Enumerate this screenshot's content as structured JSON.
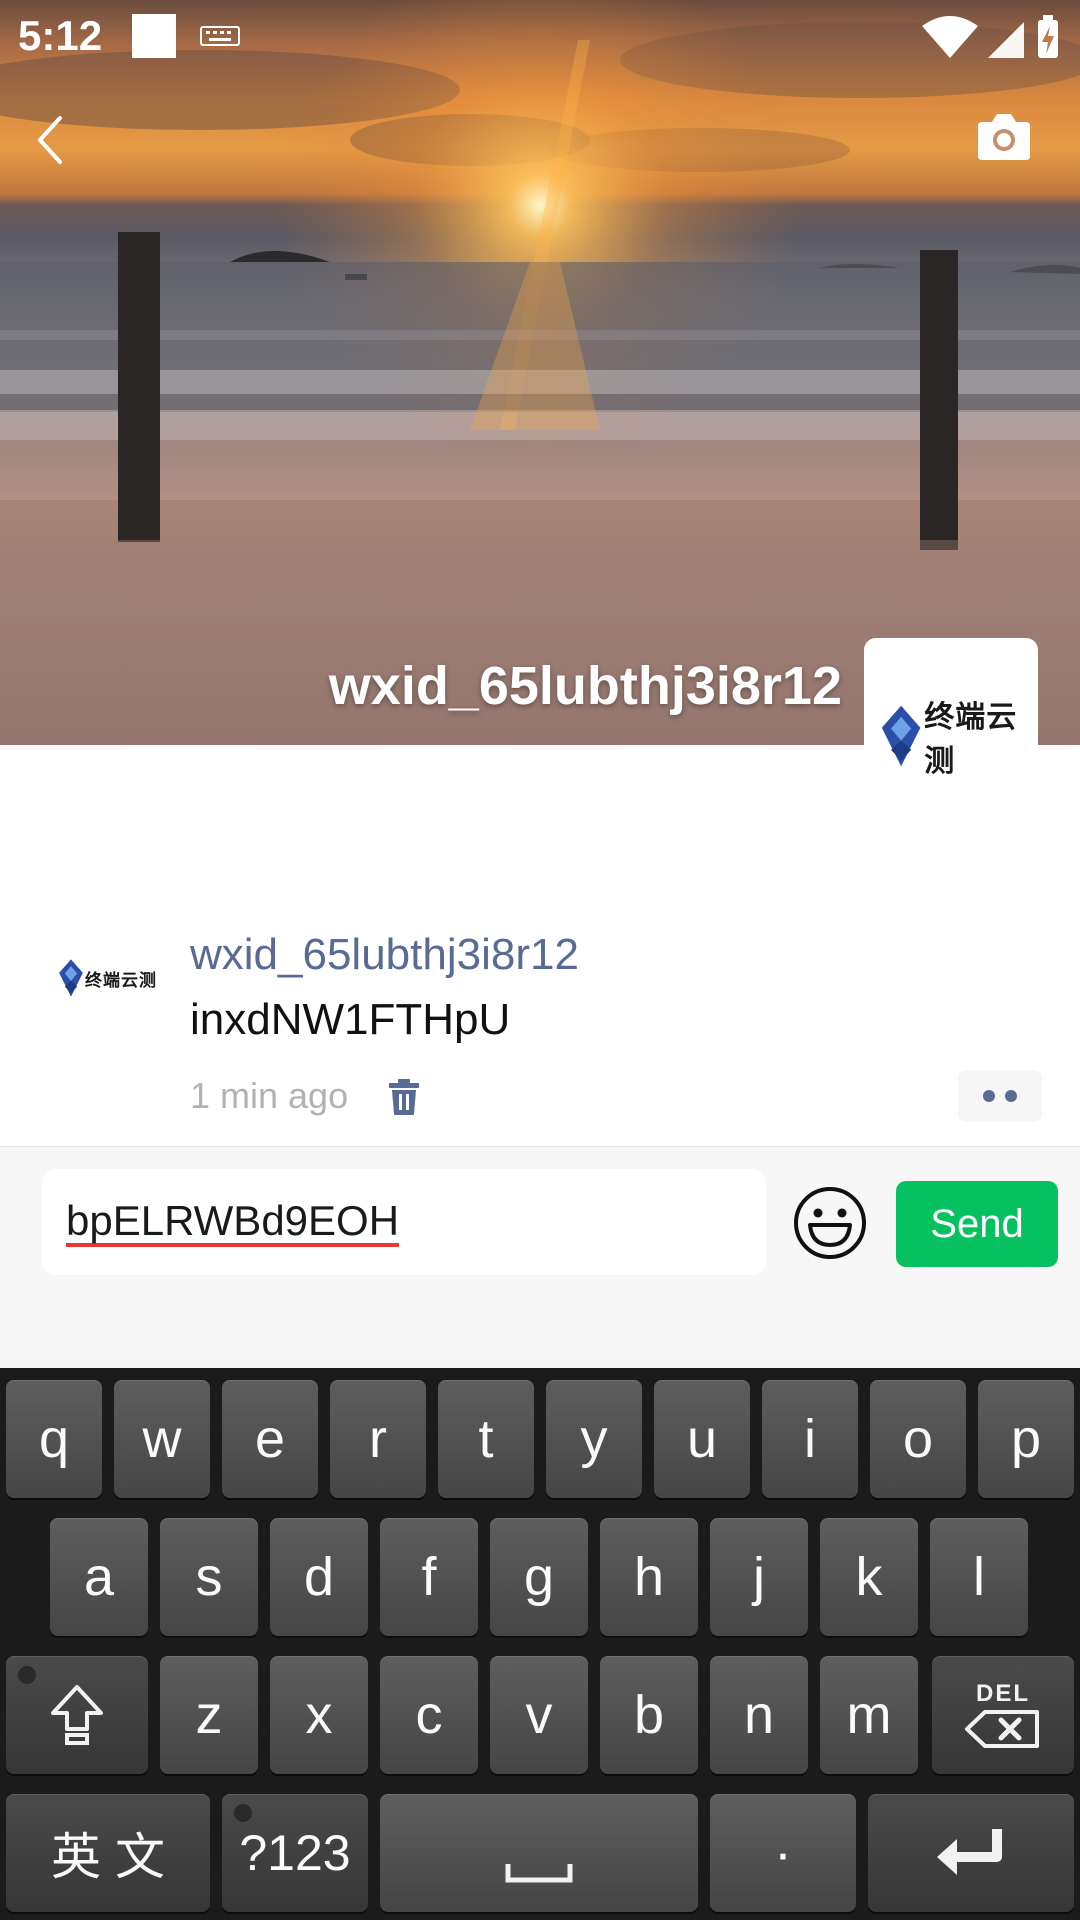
{
  "status_bar": {
    "time": "5:12"
  },
  "profile": {
    "name": "wxid_65lubthj3i8r12",
    "avatar_logo_text": "终端云测"
  },
  "post": {
    "author": "wxid_65lubthj3i8r12",
    "text": "inxdNW1FTHpU",
    "time": "1 min ago",
    "avatar_logo_text": "终端云测"
  },
  "comment": {
    "input_value": "bpELRWBd9EOH",
    "send_label": "Send"
  },
  "keyboard": {
    "row1": [
      "q",
      "w",
      "e",
      "r",
      "t",
      "y",
      "u",
      "i",
      "o",
      "p"
    ],
    "row2": [
      "a",
      "s",
      "d",
      "f",
      "g",
      "h",
      "j",
      "k",
      "l"
    ],
    "row3": [
      "z",
      "x",
      "c",
      "v",
      "b",
      "n",
      "m"
    ],
    "delete_label": "DEL",
    "lang_label": "英 文",
    "symbols_label": "?123",
    "period_label": "·"
  },
  "colors": {
    "link_blue": "#576b95",
    "send_green": "#07c160",
    "spellcheck_red": "#e53935"
  },
  "icons": [
    "back-icon",
    "camera-icon",
    "delete-icon",
    "more-icon",
    "emoji-icon",
    "shift-icon",
    "delete-key-icon",
    "space-icon",
    "enter-icon",
    "wifi-icon",
    "signal-icon",
    "battery-icon",
    "keyboard-status-icon"
  ]
}
